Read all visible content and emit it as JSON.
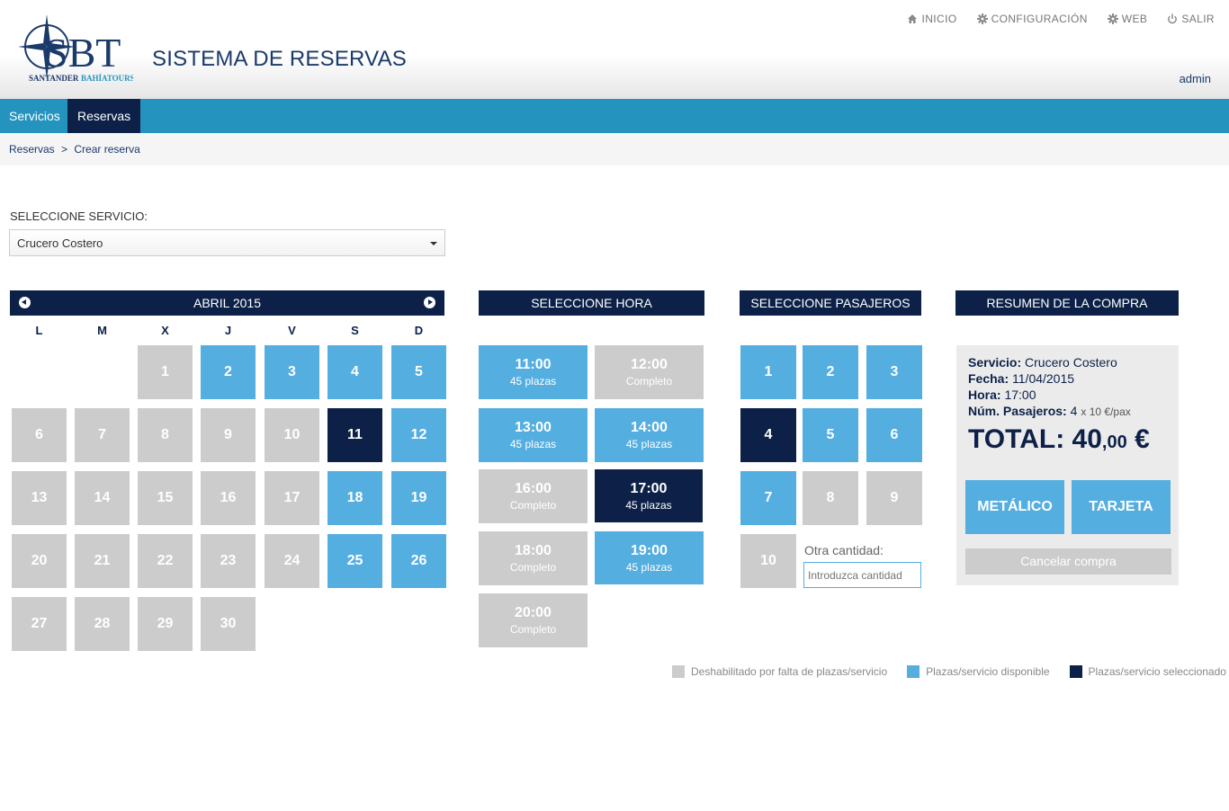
{
  "header": {
    "logo_big": "SBT",
    "logo_sub_1": "SANTANDER",
    "logo_sub_2": "BAHÍATOURS",
    "title": "SISTEMA DE RESERVAS",
    "links": [
      {
        "label": "INICIO",
        "icon": "home-icon"
      },
      {
        "label": "CONFIGURACIÓN",
        "icon": "gear-icon"
      },
      {
        "label": "WEB",
        "icon": "gear-icon"
      },
      {
        "label": "SALIR",
        "icon": "power-icon"
      }
    ],
    "user": "admin"
  },
  "nav": {
    "tabs": [
      "Servicios",
      "Reservas"
    ],
    "active": "Reservas"
  },
  "breadcrumb": {
    "items": [
      "Reservas",
      "Crear reserva"
    ],
    "separator": ">"
  },
  "service": {
    "label": "SELECCIONE SERVICIO:",
    "selected": "Crucero Costero"
  },
  "calendar": {
    "month": "ABRIL 2015",
    "weekdays": [
      "L",
      "M",
      "X",
      "J",
      "V",
      "S",
      "D"
    ],
    "first_weekday_index": 2,
    "days": [
      {
        "n": "1",
        "state": "gray"
      },
      {
        "n": "2",
        "state": "blue"
      },
      {
        "n": "3",
        "state": "blue"
      },
      {
        "n": "4",
        "state": "blue"
      },
      {
        "n": "5",
        "state": "blue"
      },
      {
        "n": "6",
        "state": "gray"
      },
      {
        "n": "7",
        "state": "gray"
      },
      {
        "n": "8",
        "state": "gray"
      },
      {
        "n": "9",
        "state": "gray"
      },
      {
        "n": "10",
        "state": "gray"
      },
      {
        "n": "11",
        "state": "navy"
      },
      {
        "n": "12",
        "state": "blue"
      },
      {
        "n": "13",
        "state": "gray"
      },
      {
        "n": "14",
        "state": "gray"
      },
      {
        "n": "15",
        "state": "gray"
      },
      {
        "n": "16",
        "state": "gray"
      },
      {
        "n": "17",
        "state": "gray"
      },
      {
        "n": "18",
        "state": "blue"
      },
      {
        "n": "19",
        "state": "blue"
      },
      {
        "n": "20",
        "state": "gray"
      },
      {
        "n": "21",
        "state": "gray"
      },
      {
        "n": "22",
        "state": "gray"
      },
      {
        "n": "23",
        "state": "gray"
      },
      {
        "n": "24",
        "state": "gray"
      },
      {
        "n": "25",
        "state": "blue"
      },
      {
        "n": "26",
        "state": "blue"
      },
      {
        "n": "27",
        "state": "gray"
      },
      {
        "n": "28",
        "state": "gray"
      },
      {
        "n": "29",
        "state": "gray"
      },
      {
        "n": "30",
        "state": "gray"
      }
    ]
  },
  "hours": {
    "title": "SELECCIONE HORA",
    "slots": [
      {
        "time": "11:00",
        "sub": "45 plazas",
        "state": "blue"
      },
      {
        "time": "12:00",
        "sub": "Completo",
        "state": "gray"
      },
      {
        "time": "13:00",
        "sub": "45 plazas",
        "state": "blue"
      },
      {
        "time": "14:00",
        "sub": "45 plazas",
        "state": "blue"
      },
      {
        "time": "16:00",
        "sub": "Completo",
        "state": "gray"
      },
      {
        "time": "17:00",
        "sub": "45 plazas",
        "state": "navy"
      },
      {
        "time": "18:00",
        "sub": "Completo",
        "state": "gray"
      },
      {
        "time": "19:00",
        "sub": "45 plazas",
        "state": "blue"
      },
      {
        "time": "20:00",
        "sub": "Completo",
        "state": "gray"
      }
    ]
  },
  "passengers": {
    "title": "SELECCIONE PASAJEROS",
    "buttons": [
      {
        "n": "1",
        "state": "blue"
      },
      {
        "n": "2",
        "state": "blue"
      },
      {
        "n": "3",
        "state": "blue"
      },
      {
        "n": "4",
        "state": "navy"
      },
      {
        "n": "5",
        "state": "blue"
      },
      {
        "n": "6",
        "state": "blue"
      },
      {
        "n": "7",
        "state": "blue"
      },
      {
        "n": "8",
        "state": "gray"
      },
      {
        "n": "9",
        "state": "gray"
      },
      {
        "n": "10",
        "state": "gray"
      }
    ],
    "other_label": "Otra cantidad:",
    "other_placeholder": "Introduzca cantidad"
  },
  "summary": {
    "title": "RESUMEN DE LA COMPRA",
    "service_label": "Servicio:",
    "service_value": "Crucero Costero",
    "date_label": "Fecha:",
    "date_value": "11/04/2015",
    "hour_label": "Hora:",
    "hour_value": "17:00",
    "pax_label": "Núm. Pasajeros:",
    "pax_value": "4",
    "pax_price": "x 10 €/pax",
    "total_label": "TOTAL:",
    "total_int": "40",
    "total_dec": ",00",
    "total_currency": "€",
    "btn_cash": "METÁLICO",
    "btn_card": "TARJETA",
    "btn_cancel": "Cancelar compra"
  },
  "legend": [
    {
      "label": "Deshabilitado por falta de plazas/servicio",
      "color": "#cccccc"
    },
    {
      "label": "Plazas/servicio disponible",
      "color": "#55aee0"
    },
    {
      "label": "Plazas/servicio seleccionado",
      "color": "#0d2148"
    }
  ],
  "colors": {
    "navy": "#0d2148",
    "blue": "#55aee0",
    "gray": "#cccccc",
    "nav": "#2494be"
  }
}
